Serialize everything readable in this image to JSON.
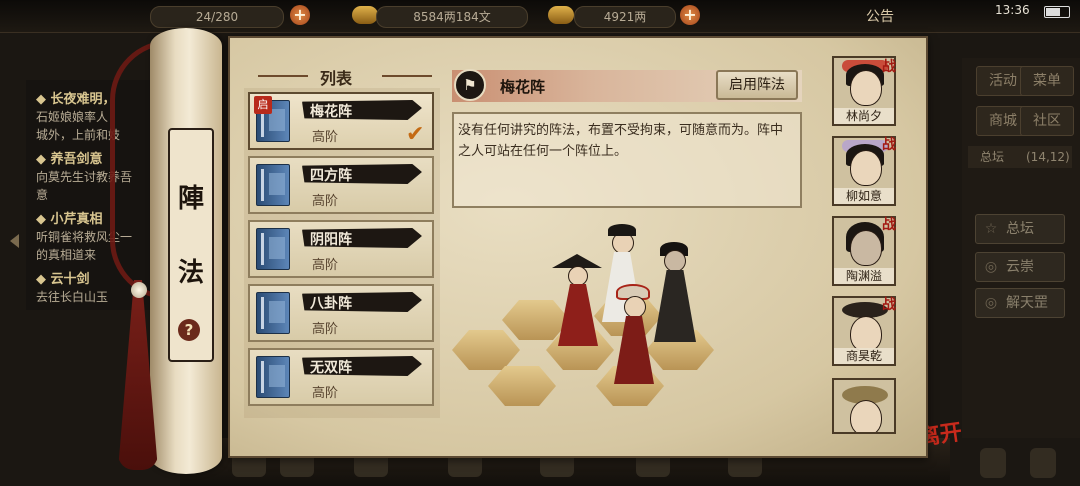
{
  "top_bar": {
    "stamina": "24/280",
    "silver": "8584两184文",
    "gold": "4921两",
    "notice": "公告",
    "time": "13:36"
  },
  "quest_panel": [
    {
      "title": "长夜难明，",
      "desc": [
        "石姬娘娘率人",
        "城外，上前和妓"
      ]
    },
    {
      "title": "养吾剑意",
      "desc": [
        "向莫先生讨教养吾",
        "意"
      ]
    },
    {
      "title": "小芹真相",
      "desc": [
        "听铜雀将救风尘一",
        "的真相道来"
      ]
    },
    {
      "title": "云十剑",
      "desc": [
        "去往长白山玉"
      ]
    }
  ],
  "right_menu": {
    "buttons": [
      "活动",
      "菜单",
      "商城",
      "社区"
    ],
    "coord_label": "总坛",
    "coord_value": "(14,12)",
    "nav": [
      "总坛",
      "云崇",
      "解天罡"
    ]
  },
  "leave_label": "离开",
  "scroll": {
    "title_1": "陣",
    "title_2": "法",
    "help": "?"
  },
  "list": {
    "header": "列表",
    "active_badge": "启",
    "items": [
      {
        "name": "梅花阵",
        "tier": "高阶"
      },
      {
        "name": "四方阵",
        "tier": "高阶"
      },
      {
        "name": "阴阳阵",
        "tier": "高阶"
      },
      {
        "name": "八卦阵",
        "tier": "高阶"
      },
      {
        "name": "无双阵",
        "tier": "高阶"
      }
    ]
  },
  "detail": {
    "name": "梅花阵",
    "activate_label": "启用阵法",
    "description": "没有任何讲究的阵法，布置不受拘束，可随意而为。阵中之人可站在任何一个阵位上。"
  },
  "roster": {
    "battle_mark": "战",
    "members": [
      {
        "name": "林尚夕",
        "in_battle": true
      },
      {
        "name": "柳如意",
        "in_battle": true
      },
      {
        "name": "陶渊溢",
        "in_battle": true
      },
      {
        "name": "商昊乾",
        "in_battle": true
      },
      {
        "name": "",
        "in_battle": false
      }
    ]
  },
  "colors": {
    "accent_red": "#a31a12",
    "paper": "#ddd0b0",
    "check": "#c46a13",
    "book_blue": "#3c66a0"
  }
}
